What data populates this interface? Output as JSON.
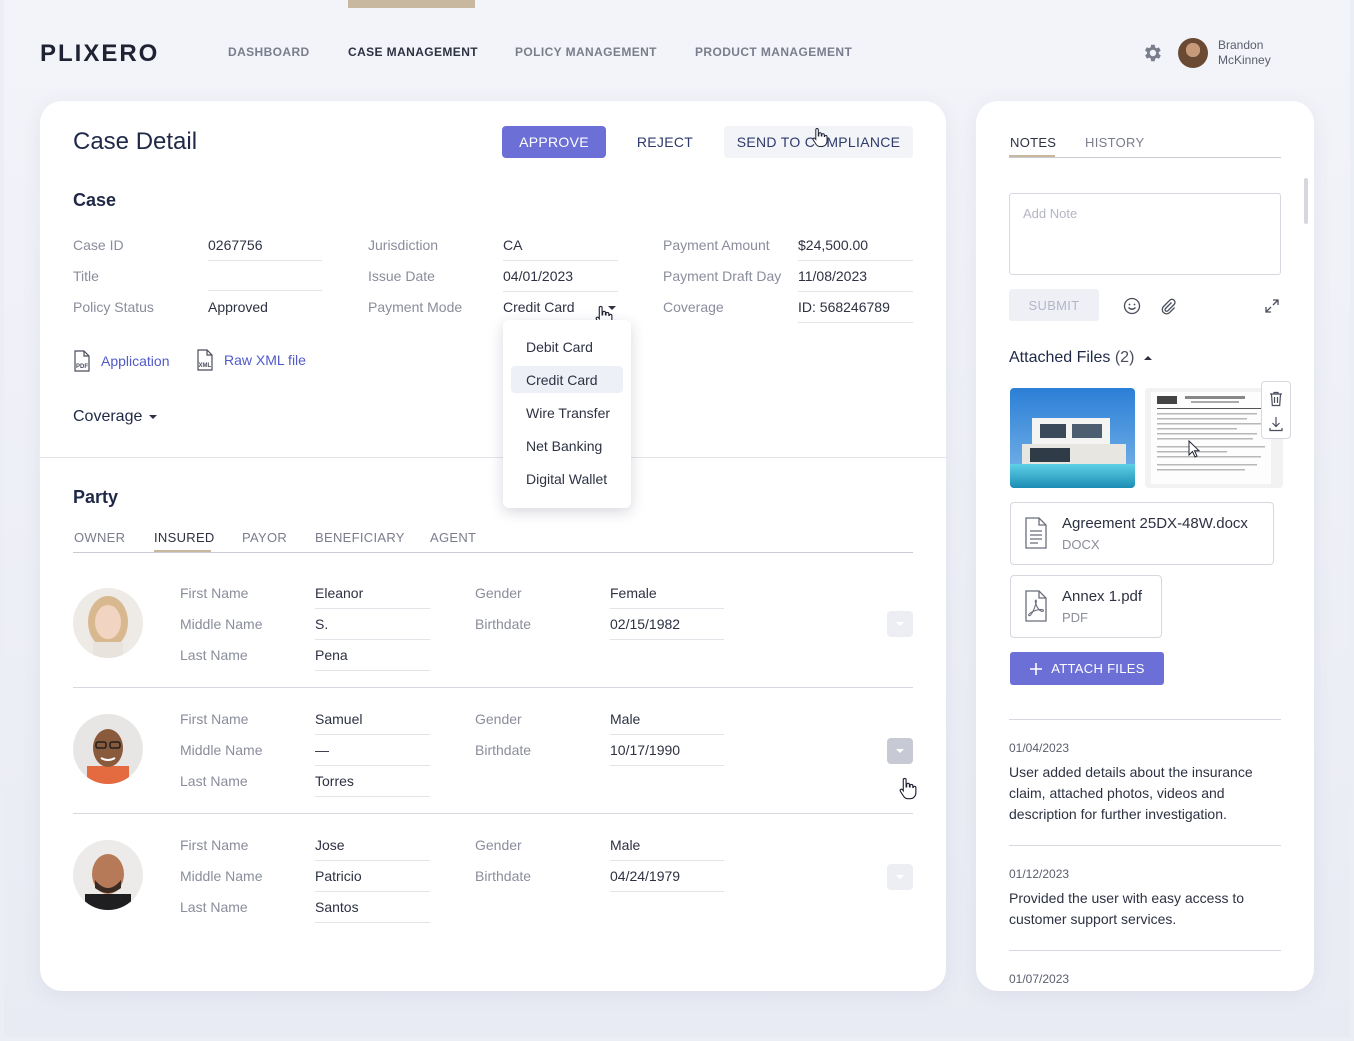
{
  "app": {
    "logo": "PLIXERO"
  },
  "nav": {
    "items": [
      {
        "label": "DASHBOARD"
      },
      {
        "label": "CASE MANAGEMENT"
      },
      {
        "label": "POLICY MANAGEMENT"
      },
      {
        "label": "PRODUCT MANAGEMENT"
      }
    ],
    "active_index": 1
  },
  "user": {
    "first": "Brandon",
    "last": "McKinney"
  },
  "case_detail": {
    "title": "Case Detail",
    "actions": {
      "approve": "APPROVE",
      "reject": "REJECT",
      "send": "SEND TO COMPLIANCE"
    },
    "case_heading": "Case",
    "fields": {
      "case_id": {
        "label": "Case ID",
        "value": "0267756"
      },
      "title": {
        "label": "Title",
        "value": ""
      },
      "policy_status": {
        "label": "Policy Status",
        "value": "Approved"
      },
      "jurisdiction": {
        "label": "Jurisdiction",
        "value": "CA"
      },
      "issue_date": {
        "label": "Issue Date",
        "value": "04/01/2023"
      },
      "payment_mode": {
        "label": "Payment Mode",
        "value": "Credit Card"
      },
      "payment_amount": {
        "label": "Payment Amount",
        "value": "$24,500.00"
      },
      "payment_draft_day": {
        "label": "Payment Draft Day",
        "value": "11/08/2023"
      },
      "coverage": {
        "label": "Coverage",
        "value": "ID: 568246789"
      }
    },
    "links": {
      "application": "Application",
      "raw_xml": "Raw XML file"
    },
    "coverage_toggle": "Coverage",
    "payment_mode_options": [
      "Debit Card",
      "Credit Card",
      "Wire Transfer",
      "Net Banking",
      "Digital Wallet"
    ],
    "payment_mode_selected": "Credit Card"
  },
  "party": {
    "heading": "Party",
    "tabs": [
      "OWNER",
      "INSURED",
      "PAYOR",
      "BENEFICIARY",
      "AGENT"
    ],
    "active_tab": "INSURED",
    "labels": {
      "first": "First Name",
      "middle": "Middle Name",
      "last": "Last Name",
      "gender": "Gender",
      "birthdate": "Birthdate"
    },
    "members": [
      {
        "first": "Eleanor",
        "middle": "S.",
        "last": "Pena",
        "gender": "Female",
        "birthdate": "02/15/1982"
      },
      {
        "first": "Samuel",
        "middle": "—",
        "last": "Torres",
        "gender": "Male",
        "birthdate": "10/17/1990"
      },
      {
        "first": "Jose",
        "middle": "Patricio",
        "last": "Santos",
        "gender": "Male",
        "birthdate": "04/24/1979"
      }
    ]
  },
  "side": {
    "tabs": [
      "NOTES",
      "HISTORY"
    ],
    "active_tab": "NOTES",
    "note_placeholder": "Add Note",
    "submit": "SUBMIT",
    "attached_heading": "Attached Files",
    "attached_count": "(2)",
    "files": [
      {
        "name": "Agreement 25DX-48W.docx",
        "type": "DOCX"
      },
      {
        "name": "Annex 1.pdf",
        "type": "PDF"
      }
    ],
    "attach_button": "ATTACH FILES",
    "notes": [
      {
        "date": "01/04/2023",
        "text": "User added details about the insurance claim, attached photos, videos and description for further investigation."
      },
      {
        "date": "01/12/2023",
        "text": "Provided the user with easy access to customer support services."
      },
      {
        "date": "01/07/2023",
        "text": ""
      }
    ]
  },
  "colors": {
    "accent": "#6b6fd6",
    "link": "#5059c9",
    "tab_underline": "#c8b8a0",
    "heading": "#1f2947"
  },
  "icons": [
    "gear-icon",
    "pdf-file-icon",
    "xml-file-icon",
    "caret-down-icon",
    "emoji-icon",
    "paperclip-icon",
    "expand-icon",
    "trash-icon",
    "download-icon",
    "document-icon",
    "pdf-icon",
    "plus-icon",
    "caret-up-icon",
    "chevron-down-icon"
  ]
}
